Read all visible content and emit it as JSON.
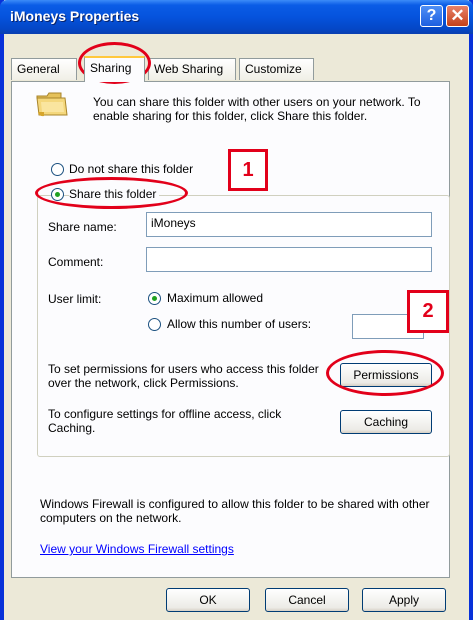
{
  "window": {
    "title": "iMoneys Properties",
    "help_glyph": "?",
    "close_glyph": "✕"
  },
  "tabs": [
    {
      "label": "General"
    },
    {
      "label": "Sharing"
    },
    {
      "label": "Web Sharing"
    },
    {
      "label": "Customize"
    }
  ],
  "intro_text": "You can share this folder with other users on your network.  To enable sharing for this folder, click Share this folder.",
  "sharing": {
    "do_not_share_label": "Do not share this folder",
    "share_label": "Share this folder",
    "selected": "share"
  },
  "fields": {
    "share_name_label": "Share name:",
    "share_name_value": "iMoneys",
    "comment_label": "Comment:",
    "comment_value": ""
  },
  "user_limit": {
    "label": "User limit:",
    "max_label": "Maximum allowed",
    "allow_label": "Allow this number of users:",
    "selected": "maximum",
    "count_value": ""
  },
  "permissions": {
    "text": "To set permissions for users who access this folder over the network, click Permissions.",
    "button": "Permissions"
  },
  "caching": {
    "text": "To configure settings for offline access, click Caching.",
    "button": "Caching"
  },
  "firewall": {
    "text": "Windows Firewall is configured to allow this folder to be shared with other computers on the network.",
    "link": "View your Windows Firewall settings"
  },
  "buttons": {
    "ok": "OK",
    "cancel": "Cancel",
    "apply": "Apply"
  },
  "annotations": {
    "step1": "1",
    "step2": "2",
    "color": "#e2001a"
  },
  "icons": {
    "folder": "shared-folder-icon",
    "help": "help-icon",
    "close": "close-icon"
  }
}
